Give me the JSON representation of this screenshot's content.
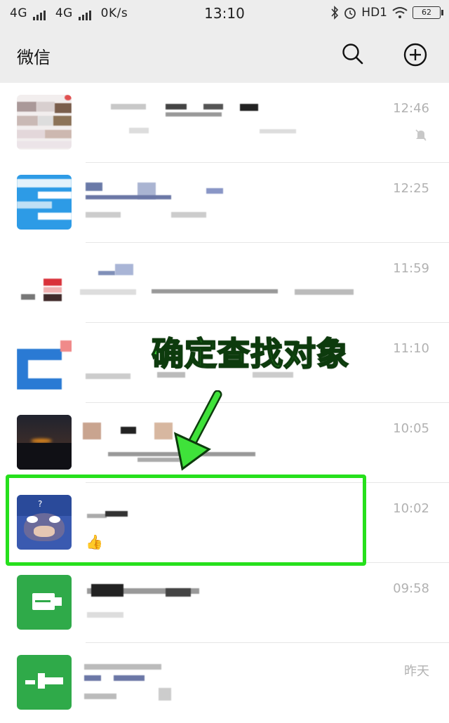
{
  "status_bar": {
    "left_text": "4G  4G  0K/s",
    "sim1": "4G",
    "sim2": "4G",
    "speed": "0K/s",
    "time": "13:10",
    "network": "HD1",
    "battery": "62"
  },
  "header": {
    "title": "微信",
    "search_icon": "search-icon",
    "add_icon": "plus-circle-icon"
  },
  "chats": [
    {
      "time": "12:46",
      "muted": true
    },
    {
      "time": "12:25"
    },
    {
      "time": "11:59"
    },
    {
      "time": "11:10"
    },
    {
      "time": "10:05"
    },
    {
      "time": "10:02",
      "preview_emoji": "👍"
    },
    {
      "time": "09:58"
    },
    {
      "time": "昨天"
    }
  ],
  "annotation": {
    "text": "确定查找对象",
    "color": "#26e01c"
  }
}
